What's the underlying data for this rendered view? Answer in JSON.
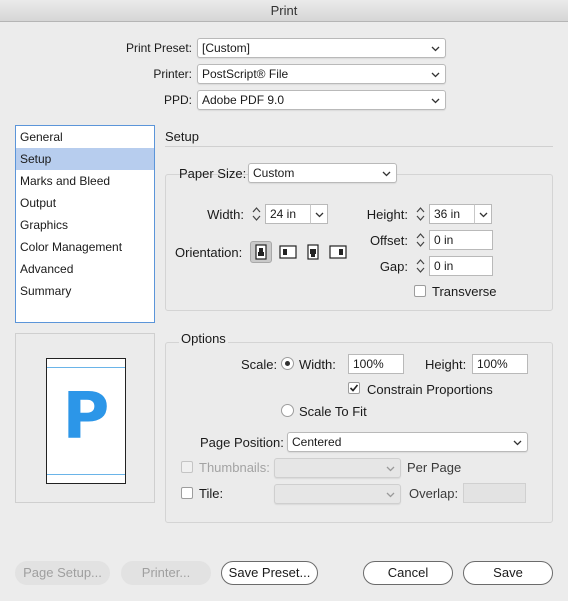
{
  "window": {
    "title": "Print"
  },
  "top": {
    "print_preset_label": "Print Preset:",
    "print_preset_value": "[Custom]",
    "printer_label": "Printer:",
    "printer_value": "PostScript® File",
    "ppd_label": "PPD:",
    "ppd_value": "Adobe PDF 9.0"
  },
  "sidebar": {
    "items": [
      {
        "label": "General"
      },
      {
        "label": "Setup"
      },
      {
        "label": "Marks and Bleed"
      },
      {
        "label": "Output"
      },
      {
        "label": "Graphics"
      },
      {
        "label": "Color Management"
      },
      {
        "label": "Advanced"
      },
      {
        "label": "Summary"
      }
    ],
    "selected": "Setup"
  },
  "setup": {
    "heading": "Setup",
    "paper_size_label": "Paper Size:",
    "paper_size_value": "Custom",
    "width_label": "Width:",
    "width_value": "24 in",
    "height_label": "Height:",
    "height_value": "36 in",
    "offset_label": "Offset:",
    "offset_value": "0 in",
    "gap_label": "Gap:",
    "gap_value": "0 in",
    "orientation_label": "Orientation:",
    "transverse_label": "Transverse",
    "transverse_checked": false
  },
  "options": {
    "heading": "Options",
    "scale_label": "Scale:",
    "width_label": "Width:",
    "width_value": "100%",
    "height_label": "Height:",
    "height_value": "100%",
    "constrain_label": "Constrain Proportions",
    "constrain_checked": true,
    "scale_to_fit_label": "Scale To Fit",
    "page_position_label": "Page Position:",
    "page_position_value": "Centered",
    "thumbnails_label": "Thumbnails:",
    "per_page_label": "Per Page",
    "tile_label": "Tile:",
    "overlap_label": "Overlap:"
  },
  "preview": {
    "letter": "P"
  },
  "buttons": {
    "page_setup": "Page Setup...",
    "printer": "Printer...",
    "save_preset": "Save Preset...",
    "cancel": "Cancel",
    "save": "Save"
  },
  "colors": {
    "selection": "#b7cdee",
    "list_border": "#5b95d9",
    "preview_letter": "#2c96e8"
  }
}
